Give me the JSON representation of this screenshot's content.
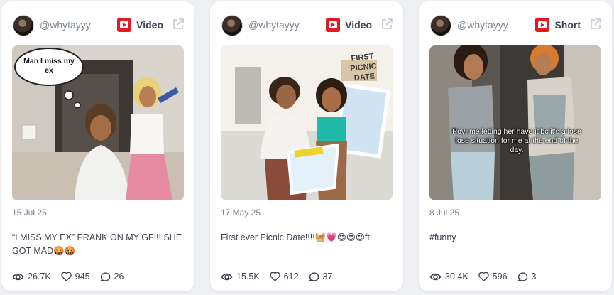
{
  "cards": [
    {
      "handle": "@whytayyy",
      "type": "Video",
      "date": "15 Jul 25",
      "title": "“I MISS MY EX” PRANK ON MY GF!!! SHE GOT MAD🤬🤬",
      "thumb_text": "Man I miss my ex",
      "views": "26.7K",
      "likes": "945",
      "comments": "26"
    },
    {
      "handle": "@whytayyy",
      "type": "Video",
      "date": "17 May 25",
      "title": "First ever Picnic Date!!!!🧺💗😍😍😍ft:",
      "thumb_text": "FIRST PICNIC DATE",
      "views": "15.5K",
      "likes": "612",
      "comments": "37"
    },
    {
      "handle": "@whytayyy",
      "type": "Short",
      "date": "8 Jul 25",
      "title": "#funny",
      "thumb_text": "Pov: me letting her have it bc it's a lose lose situation for me at the end of the day.",
      "views": "30.4K",
      "likes": "596",
      "comments": "3"
    }
  ],
  "icons": {
    "platform": "youtube-icon",
    "external": "external-link-icon",
    "views": "eye-icon",
    "likes": "heart-icon",
    "comments": "comment-icon"
  },
  "colors": {
    "brand_red": "#e21b23",
    "text": "#3b4250",
    "muted": "#7b8594"
  }
}
